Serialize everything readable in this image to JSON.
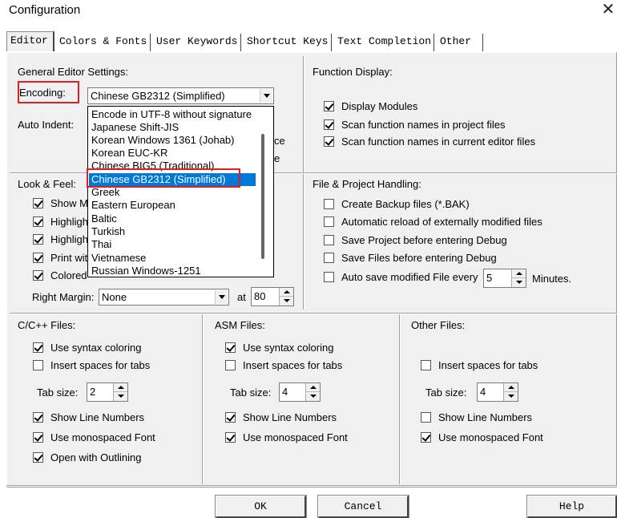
{
  "window": {
    "title": "Configuration",
    "close_glyph": "✕"
  },
  "tabs": [
    "Editor",
    "Colors & Fonts",
    "User Keywords",
    "Shortcut Keys",
    "Text Completion",
    "Other"
  ],
  "general": {
    "heading": "General Editor Settings:",
    "encoding_label": "Encoding:",
    "encoding_value": "Chinese GB2312 (Simplified)",
    "auto_indent_label": "Auto Indent:",
    "hidden_fragment_1": "ce",
    "hidden_fragment_2": "e"
  },
  "encoding_options": [
    "Encode in UTF-8 without signature",
    "Japanese Shift-JIS",
    "Korean Windows 1361 (Johab)",
    "Korean EUC-KR",
    "Chinese BIG5 (Traditional)",
    "Chinese GB2312 (Simplified)",
    "Greek",
    "Eastern European",
    "Baltic",
    "Turkish",
    "Thai",
    "Vietnamese",
    "Russian Windows-1251"
  ],
  "function_display": {
    "heading": "Function Display:",
    "items": [
      {
        "label": "Display Modules",
        "checked": true
      },
      {
        "label": "Scan function names in project files",
        "checked": true
      },
      {
        "label": "Scan function names in current editor files",
        "checked": true
      }
    ]
  },
  "look_feel": {
    "heading": "Look & Feel:",
    "items": [
      {
        "label": "Show M",
        "checked": true
      },
      {
        "label": "Highligh",
        "checked": true
      },
      {
        "label": "Highligh",
        "checked": true
      },
      {
        "label": "Print wit",
        "checked": true
      },
      {
        "label": "Colored",
        "checked": true
      }
    ],
    "right_margin_label": "Right Margin:",
    "right_margin_value": "None",
    "at_label": "at",
    "at_value": "80"
  },
  "file_project": {
    "heading": "File & Project Handling:",
    "items": [
      {
        "label": "Create Backup files (*.BAK)",
        "checked": false
      },
      {
        "label": "Automatic reload of externally modified files",
        "checked": false
      },
      {
        "label": "Save Project before entering Debug",
        "checked": false
      },
      {
        "label": "Save Files before entering Debug",
        "checked": false
      },
      {
        "label": "Auto save modified File every",
        "checked": false
      }
    ],
    "autosave_value": "5",
    "minutes_label": "Minutes."
  },
  "cpp_files": {
    "heading": "C/C++ Files:",
    "syntax": {
      "label": "Use syntax coloring",
      "checked": true
    },
    "spaces": {
      "label": "Insert spaces for tabs",
      "checked": false
    },
    "tab_size_label": "Tab size:",
    "tab_size": "2",
    "line_numbers": {
      "label": "Show Line Numbers",
      "checked": true
    },
    "mono": {
      "label": "Use monospaced Font",
      "checked": true
    },
    "outlining": {
      "label": "Open with Outlining",
      "checked": true
    }
  },
  "asm_files": {
    "heading": "ASM Files:",
    "syntax": {
      "label": "Use syntax coloring",
      "checked": true
    },
    "spaces": {
      "label": "Insert spaces for tabs",
      "checked": false
    },
    "tab_size_label": "Tab size:",
    "tab_size": "4",
    "line_numbers": {
      "label": "Show Line Numbers",
      "checked": true
    },
    "mono": {
      "label": "Use monospaced Font",
      "checked": true
    }
  },
  "other_files": {
    "heading": "Other Files:",
    "spaces": {
      "label": "Insert spaces for tabs",
      "checked": false
    },
    "tab_size_label": "Tab size:",
    "tab_size": "4",
    "line_numbers": {
      "label": "Show Line Numbers",
      "checked": false
    },
    "mono": {
      "label": "Use monospaced Font",
      "checked": true
    }
  },
  "buttons": {
    "ok": "OK",
    "cancel": "Cancel",
    "help": "Help"
  },
  "colors": {
    "selection": "#0078d7",
    "highlight_box": "#e02020",
    "dialog_bg": "#f0f0f0"
  }
}
